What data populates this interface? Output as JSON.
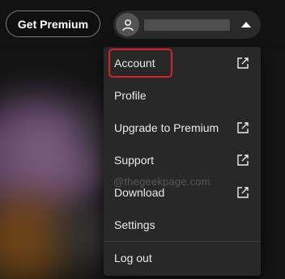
{
  "header": {
    "premium_button_label": "Get Premium"
  },
  "user_menu": {
    "avatar_icon": "user-icon",
    "caret_icon": "caret-up-icon"
  },
  "menu": {
    "items": [
      {
        "label": "Account",
        "external": true
      },
      {
        "label": "Profile",
        "external": false
      },
      {
        "label": "Upgrade to Premium",
        "external": true
      },
      {
        "label": "Support",
        "external": true
      },
      {
        "label": "Download",
        "external": true
      },
      {
        "label": "Settings",
        "external": false
      },
      {
        "label": "Log out",
        "external": false
      }
    ],
    "external_icon": "external-link-icon"
  },
  "annotation": {
    "highlight_color": "#d8202a"
  },
  "watermark": "@thegeekpage.com"
}
